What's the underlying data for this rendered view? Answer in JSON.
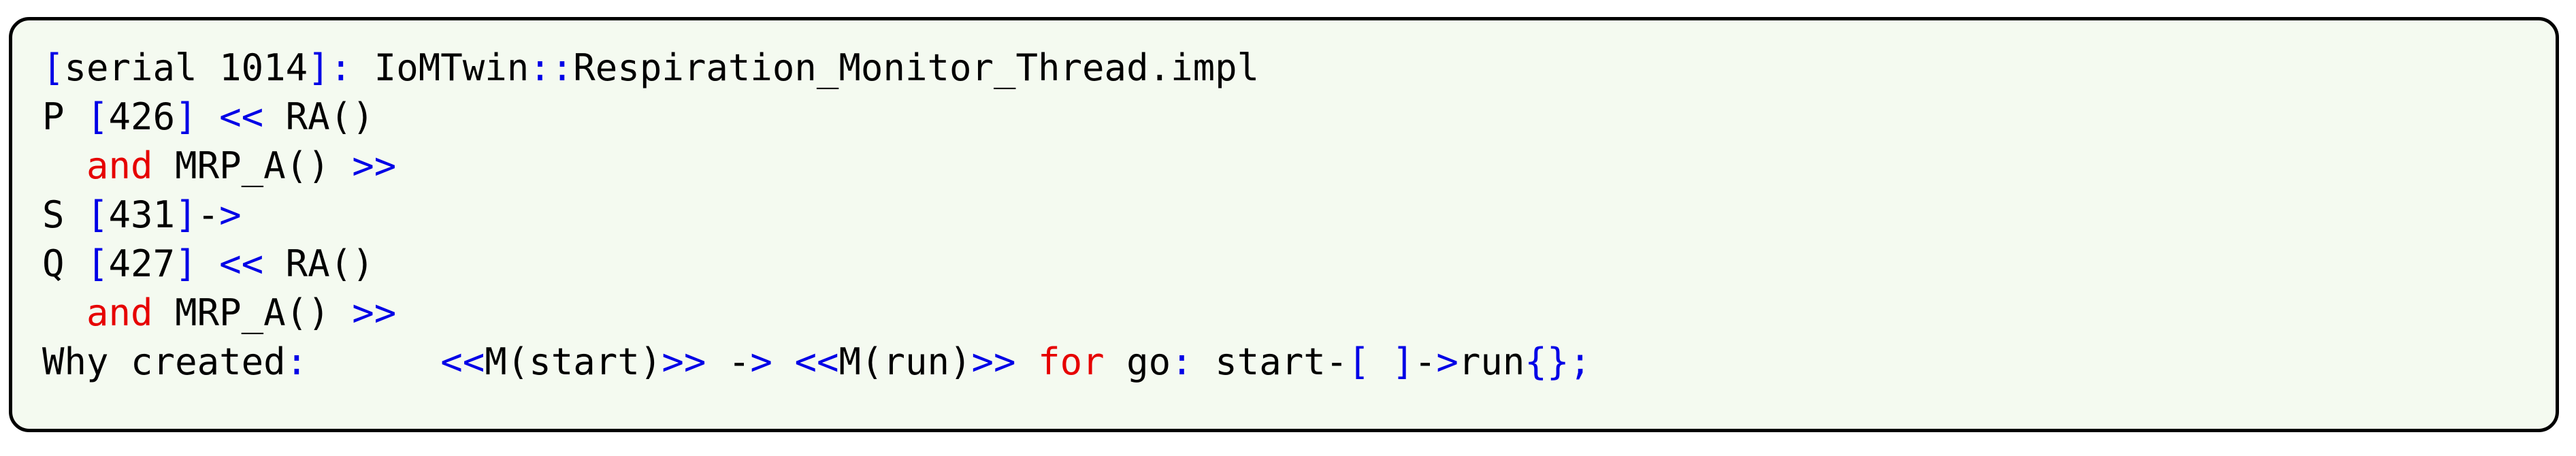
{
  "theme": {
    "background": "#f4faf0",
    "border_color": "#000000",
    "text_color": "#000000",
    "accent_blue": "#0000e6",
    "accent_red": "#e60000"
  },
  "listing": {
    "lines": [
      {
        "id": "line-1",
        "tokens": [
          {
            "t": "[",
            "c": "blue"
          },
          {
            "t": "serial 1014",
            "c": "black"
          },
          {
            "t": "]",
            "c": "blue"
          },
          {
            "t": ":",
            "c": "blue"
          },
          {
            "t": " IoMTwin",
            "c": "black"
          },
          {
            "t": "::",
            "c": "blue"
          },
          {
            "t": "Respiration_Monitor_Thread.impl",
            "c": "black"
          }
        ]
      },
      {
        "id": "line-2",
        "tokens": [
          {
            "t": "P ",
            "c": "black"
          },
          {
            "t": "[",
            "c": "blue"
          },
          {
            "t": "426",
            "c": "black"
          },
          {
            "t": "]",
            "c": "blue"
          },
          {
            "t": " ",
            "c": "black"
          },
          {
            "t": "<<",
            "c": "blue"
          },
          {
            "t": " RA()",
            "c": "black"
          }
        ]
      },
      {
        "id": "line-3",
        "tokens": [
          {
            "t": "  ",
            "c": "black"
          },
          {
            "t": "and",
            "c": "red"
          },
          {
            "t": " MRP_A() ",
            "c": "black"
          },
          {
            "t": ">>",
            "c": "blue"
          }
        ]
      },
      {
        "id": "line-4",
        "tokens": [
          {
            "t": "S ",
            "c": "black"
          },
          {
            "t": "[",
            "c": "blue"
          },
          {
            "t": "431",
            "c": "black"
          },
          {
            "t": "]",
            "c": "blue"
          },
          {
            "t": "-",
            "c": "black"
          },
          {
            "t": ">",
            "c": "blue"
          }
        ]
      },
      {
        "id": "line-5",
        "tokens": [
          {
            "t": "Q ",
            "c": "black"
          },
          {
            "t": "[",
            "c": "blue"
          },
          {
            "t": "427",
            "c": "black"
          },
          {
            "t": "]",
            "c": "blue"
          },
          {
            "t": " ",
            "c": "black"
          },
          {
            "t": "<<",
            "c": "blue"
          },
          {
            "t": " RA()",
            "c": "black"
          }
        ]
      },
      {
        "id": "line-6",
        "tokens": [
          {
            "t": "  ",
            "c": "black"
          },
          {
            "t": "and",
            "c": "red"
          },
          {
            "t": " MRP_A() ",
            "c": "black"
          },
          {
            "t": ">>",
            "c": "blue"
          }
        ]
      },
      {
        "id": "line-7",
        "tokens": [
          {
            "t": "Why created",
            "c": "black"
          },
          {
            "t": ":",
            "c": "blue"
          },
          {
            "t": "      ",
            "c": "black"
          },
          {
            "t": "<<",
            "c": "blue"
          },
          {
            "t": "M(start)",
            "c": "black"
          },
          {
            "t": ">>",
            "c": "blue"
          },
          {
            "t": " ",
            "c": "black"
          },
          {
            "t": "-",
            "c": "black"
          },
          {
            "t": ">",
            "c": "blue"
          },
          {
            "t": " ",
            "c": "black"
          },
          {
            "t": "<<",
            "c": "blue"
          },
          {
            "t": "M(run)",
            "c": "black"
          },
          {
            "t": ">>",
            "c": "blue"
          },
          {
            "t": " ",
            "c": "black"
          },
          {
            "t": "for",
            "c": "red"
          },
          {
            "t": " go",
            "c": "black"
          },
          {
            "t": ":",
            "c": "blue"
          },
          {
            "t": " start",
            "c": "black"
          },
          {
            "t": "-",
            "c": "black"
          },
          {
            "t": "[",
            "c": "blue"
          },
          {
            "t": " ",
            "c": "black"
          },
          {
            "t": "]",
            "c": "blue"
          },
          {
            "t": "-",
            "c": "black"
          },
          {
            "t": ">",
            "c": "blue"
          },
          {
            "t": "run",
            "c": "black"
          },
          {
            "t": "{",
            "c": "blue"
          },
          {
            "t": "}",
            "c": "blue"
          },
          {
            "t": ";",
            "c": "blue"
          }
        ]
      }
    ],
    "plain_text": "[serial 1014]: IoMTwin::Respiration_Monitor_Thread.impl\nP [426] << RA()\n  and MRP_A() >>\nS [431]->\nQ [427] << RA()\n  and MRP_A() >>\nWhy created:      <<M(start)>> -> <<M(run)>> for go: start-[ ]->run{};"
  }
}
